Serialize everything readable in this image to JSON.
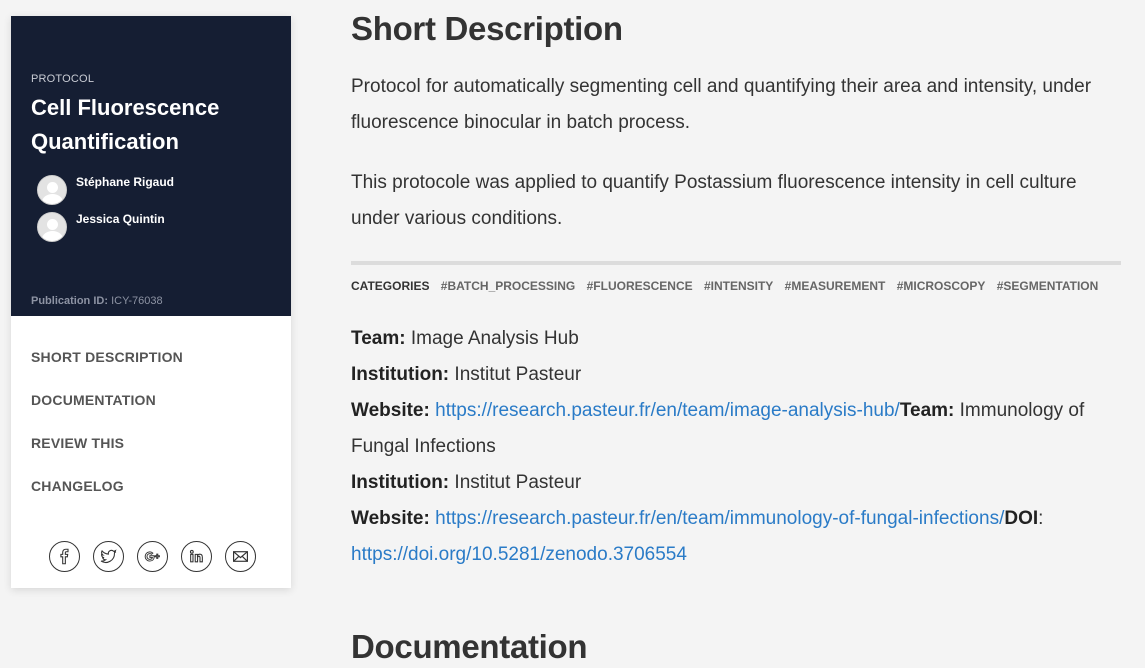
{
  "sidebar": {
    "type_label": "PROTOCOL",
    "title": "Cell Fluorescence Quantification",
    "authors": [
      {
        "name": "Stéphane Rigaud"
      },
      {
        "name": "Jessica Quintin"
      }
    ],
    "publication_id_label": "Publication ID:",
    "publication_id": "ICY-76038",
    "nav": [
      "SHORT DESCRIPTION",
      "DOCUMENTATION",
      "REVIEW THIS",
      "CHANGELOG"
    ],
    "social_icons": [
      "facebook-icon",
      "twitter-icon",
      "google-plus-icon",
      "linkedin-icon",
      "mail-icon"
    ],
    "header_bg": "#151e33"
  },
  "main": {
    "short_description_title": "Short Description",
    "paragraph1": "Protocol for automatically segmenting cell and quantifying their area and intensity, under fluorescence binocular in batch process.",
    "paragraph2": "This protocole was applied to quantify Postassium fluorescence intensity in cell culture under various conditions.",
    "categories_label": "CATEGORIES",
    "categories": [
      "#BATCH_PROCESSING",
      "#FLUORESCENCE",
      "#INTENSITY",
      "#MEASUREMENT",
      "#MICROSCOPY",
      "#SEGMENTATION"
    ],
    "team_label": "Team:",
    "team1": "Image Analysis Hub",
    "institution_label": "Institution:",
    "institution1": "Institut Pasteur",
    "website_label": "Website:",
    "website1": "https://research.pasteur.fr/en/team/image-analysis-hub/",
    "team2": "Immunology of Fungal Infections",
    "institution2": "Institut Pasteur",
    "website2": "https://research.pasteur.fr/en/team/immunology-of-fungal-infections/",
    "doi_label": "DOI",
    "doi_sep": ":",
    "doi": "https://doi.org/10.5281/zenodo.3706554",
    "documentation_title": "Documentation",
    "link_color": "#2a7bc7"
  }
}
